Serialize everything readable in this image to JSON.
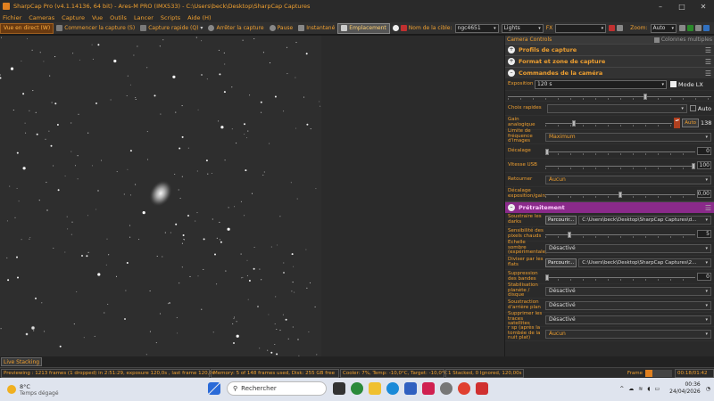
{
  "window": {
    "title": "SharpCap Pro (v4.1.14136, 64 bit) - Ares-M PRO (IMX533) - C:\\Users\\beck\\Desktop\\SharpCap Captures"
  },
  "menu": [
    "Fichier",
    "Cameras",
    "Capture",
    "Vue",
    "Outils",
    "Lancer",
    "Scripts",
    "Aide (H)"
  ],
  "toolbar": {
    "live_view": "Vue en direct (W)",
    "start_capture": "Commencer la capture (S)",
    "quick_capture": "Capture rapide (Q)",
    "stop_capture": "Arrêter la capture",
    "pause": "Pause",
    "snapshot": "Instantané",
    "placement": "Emplacement",
    "target_label": "Nom de la cible:",
    "target_value": "ngc4651",
    "frame_type": "Lights",
    "fx_label": "FX",
    "zoom_label": "Zoom:",
    "zoom_value": "Auto"
  },
  "panel": {
    "header": "Camera Controls",
    "multi_columns": "Colonnes multiples",
    "sections": {
      "capture_profiles": "Profils de capture",
      "format": "Format et zone de capture",
      "camera_controls": "Commandes de la caméra",
      "preprocessing": "Prétraitement"
    },
    "exposure": {
      "label": "Exposition",
      "value": "120 s",
      "lx_mode": "Mode LX",
      "position": 0.68
    },
    "quick_choices": {
      "label": "Choix rapides",
      "auto": "Auto"
    },
    "analog_gain": {
      "label": "Gain analogique",
      "auto": "Auto",
      "value": "138",
      "position": 0.22
    },
    "frame_rate": {
      "label": "Limite de fréquence d'images",
      "value": "Maximum"
    },
    "offset": {
      "label": "Décalage",
      "value": "0",
      "position": 0.0
    },
    "usb_speed": {
      "label": "Vitesse USB",
      "value": "100",
      "position": 1.0
    },
    "flip": {
      "label": "Retourner",
      "value": "Aucun"
    },
    "exposure_gain_offset": {
      "label": "Décalage exposition/gain",
      "value": "0,00",
      "position": 0.5
    },
    "subtract_darks": {
      "label": "Soustraire les darks",
      "browse": "Parcourir...",
      "path": "C:\\Users\\beck\\Desktop\\SharpCap Captures\\d..."
    },
    "hot_pixel": {
      "label": "Sensibilité des pixels chauds",
      "value": "5",
      "position": 0.15
    },
    "dark_scale": {
      "label": "Echelle sombre (expérimentale)",
      "value": "Désactivé"
    },
    "divide_flats": {
      "label": "Diviser par les flats",
      "browse": "Parcourir...",
      "path": "C:\\Users\\beck\\Desktop\\SharpCap Captures\\2..."
    },
    "banding": {
      "label": "Suppression des bandes",
      "value": "0",
      "position": 0.0
    },
    "stabilization": {
      "label": "Stabilisation planète / disque",
      "value": "Désactivé"
    },
    "background_sub": {
      "label": "Soustraction d'arrière plan",
      "value": "Désactivé"
    },
    "satellite_trails": {
      "label": "Supprimer les traces satellites",
      "value": "Désactivé"
    },
    "last": {
      "label": "r sp (après la tombée de la nuit plat)",
      "value": "Aucun"
    }
  },
  "live_stacking": "Live Stacking",
  "status": {
    "previewing": "Previewing : 1213 frames (1 dropped) in 2:51:29, exposure 120,0s , last frame 120,0s",
    "memory": "Memory: 5 of 148 frames used, Disk: 255 GB free",
    "cooler": "Cooler: 7%, Temp: -10,0°C, Target: -10,0°C",
    "stacked": "1 Stacked, 0 Ignored, 120,00s",
    "frame_label": "Frame",
    "elapsed": "00:18/01:42"
  },
  "taskbar": {
    "temp": "8°C",
    "weather": "Temps dégagé",
    "search": "Rechercher",
    "time": "00:36",
    "date": "24/04/2026"
  },
  "colors": {
    "accent": "#f0a030",
    "preprocessing": "#8a2a8a"
  }
}
